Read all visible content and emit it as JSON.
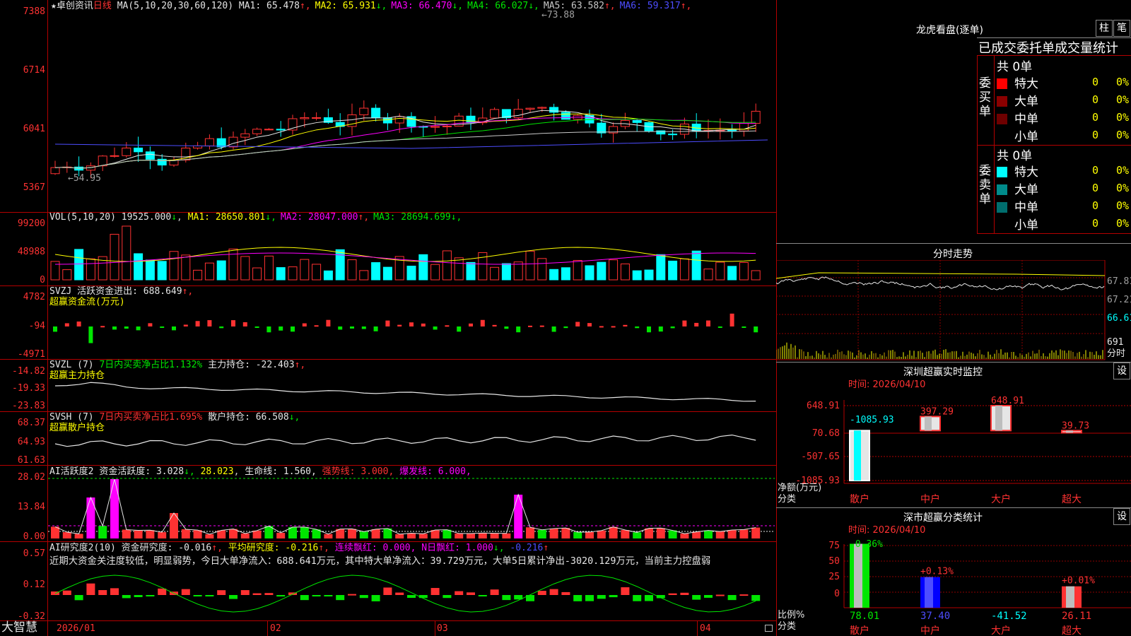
{
  "stock": {
    "name": "卓创资讯",
    "period": "日线",
    "star": "★"
  },
  "main_panel": {
    "ma_label": "MA(5,10,20,30,60,120)",
    "ma": [
      {
        "label": "MA1:",
        "value": "65.478",
        "arrow": "↑",
        "color": "#e6e6e6"
      },
      {
        "label": "MA2:",
        "value": "65.931",
        "arrow": "↓",
        "color": "#ffff00"
      },
      {
        "label": "MA3:",
        "value": "66.470",
        "arrow": "↓",
        "color": "#ff00ff"
      },
      {
        "label": "MA4:",
        "value": "66.027",
        "arrow": "↓",
        "color": "#00e600"
      },
      {
        "label": "MA5:",
        "value": "63.582",
        "arrow": "↑",
        "color": "#c8c8c8"
      },
      {
        "label": "MA6:",
        "value": "59.317",
        "arrow": "↑",
        "color": "#4d4dff"
      }
    ],
    "yticks": [
      "7388",
      "6714",
      "6041",
      "5367"
    ],
    "high_mark": "73.88",
    "low_mark": "54.95"
  },
  "vol_panel": {
    "label": "VOL(5,10,20)",
    "value": "19525.000",
    "arrow": "↓",
    "ma": [
      {
        "label": "MA1:",
        "value": "28650.801",
        "arrow": "↓",
        "color": "#ffff00"
      },
      {
        "label": "MA2:",
        "value": "28047.000",
        "arrow": "↑",
        "color": "#ff00ff"
      },
      {
        "label": "MA3:",
        "value": "28694.699",
        "arrow": "↓",
        "color": "#00e600"
      }
    ],
    "yticks": [
      "99200",
      "48988",
      "0"
    ]
  },
  "svzj_panel": {
    "label": "SVZJ",
    "indicator": "活跃资金进出:",
    "value": "688.649",
    "arrow": "↑,",
    "subtitle": "超赢资金流(万元)",
    "yticks": [
      "4782",
      "-94",
      "-4971"
    ]
  },
  "svzl_panel": {
    "label": "SVZL (7)",
    "ratio": "7日内买卖净占比1.132%",
    "hold": "主力持仓:",
    "value": "-22.403",
    "arrow": "↑,",
    "subtitle": "超赢主力持仓",
    "yticks": [
      "-14.82",
      "-19.33",
      "-23.83"
    ]
  },
  "svsh_panel": {
    "label": "SVSH (7)",
    "ratio": "7日内买卖净占比1.695%",
    "hold": "散户持仓:",
    "value": "66.508",
    "arrow": "↓,",
    "subtitle": "超赢散户持仓",
    "yticks": [
      "68.37",
      "64.93",
      "61.63"
    ]
  },
  "ai_active_panel": {
    "label": "AI活跃度2",
    "indicator": "资金活跃度:",
    "value": "3.028",
    "arrow": "↓,",
    "v2": "28.023",
    "life": "生命线:",
    "life_v": "1.560,",
    "strong": "强势线: 3.000,",
    "burst": "爆发线: 6.000,",
    "yticks": [
      "28.02",
      "13.84",
      "0.00"
    ]
  },
  "ai_research_panel": {
    "label": "AI研究度2(10)",
    "indicator": "资金研究度:",
    "value": "-0.016",
    "arrow": "↑,",
    "avg": "平均研究度:",
    "avg_v": "-0.216",
    "avg_arrow": "↑,",
    "cont": "连续飘红: 0.000,",
    "nday": "N日飘红: 1.000",
    "nday_arrow": "↓,",
    "last": "-0.216",
    "last_arrow": "↑",
    "summary": "近期大资金关注度较低，明显弱势，今日大单净流入：688.641万元，其中特大单净流入：39.729万元，大单5日累计净出-3020.129万元，当前主力控盘弱",
    "yticks": [
      "0.57",
      "0.12",
      "-0.32"
    ]
  },
  "xaxis": {
    "labels": [
      "2026/01",
      "02",
      "03",
      "04"
    ],
    "brand": "大智慧"
  },
  "dragon_tiger": {
    "title": "龙虎看盘(逐单)",
    "btn1": "柱",
    "btn2": "笔",
    "tabs": "已成交委托单成交量统计",
    "buy": {
      "side": "委买单",
      "total": "共 0单",
      "rows": [
        {
          "label": "特大",
          "color": "#ff0000",
          "vol": "0",
          "pct": "0%"
        },
        {
          "label": "大单",
          "color": "#8b0000",
          "vol": "0",
          "pct": "0%"
        },
        {
          "label": "中单",
          "color": "#6e0000",
          "vol": "0",
          "pct": "0%"
        },
        {
          "label": "小单",
          "color": "#000000",
          "vol": "0",
          "pct": "0%"
        }
      ]
    },
    "sell": {
      "side": "委卖单",
      "total": "共 0单",
      "rows": [
        {
          "label": "特大",
          "color": "#00ffff",
          "vol": "0",
          "pct": "0%"
        },
        {
          "label": "大单",
          "color": "#008b8b",
          "vol": "0",
          "pct": "0%"
        },
        {
          "label": "中单",
          "color": "#006e6e",
          "vol": "0",
          "pct": "0%"
        },
        {
          "label": "小单",
          "color": "#000000",
          "vol": "0",
          "pct": "0%"
        }
      ]
    }
  },
  "intraday": {
    "title": "分时走势",
    "yticks": [
      "67.81",
      "67.21",
      "66.61",
      "691",
      "分时"
    ]
  },
  "sz_monitor": {
    "title": "深圳超赢实时监控",
    "setting": "设",
    "time": "时间: 2026/04/10",
    "yticks": [
      "648.91",
      "70.68",
      "-507.65",
      "-1085.93"
    ],
    "ylabel": "净额(万元)",
    "xlabel": "分类",
    "categories": [
      "散户",
      "中户",
      "大户",
      "超大"
    ],
    "values": [
      "-1085.93",
      "397.29",
      "648.91",
      "39.73"
    ]
  },
  "sz_category": {
    "title": "深市超赢分类统计",
    "setting": "设",
    "time": "时间: 2026/04/10",
    "yticks": [
      "75",
      "50",
      "25",
      "0"
    ],
    "ylabel": "比例%",
    "xlabel": "分类",
    "categories": [
      "散户",
      "中户",
      "大户",
      "超大"
    ],
    "pct_labels": [
      "-0.36%",
      "+0.13%",
      "",
      "+0.01%"
    ],
    "values": [
      "78.01",
      "37.40",
      "-41.52",
      "26.11"
    ]
  }
}
